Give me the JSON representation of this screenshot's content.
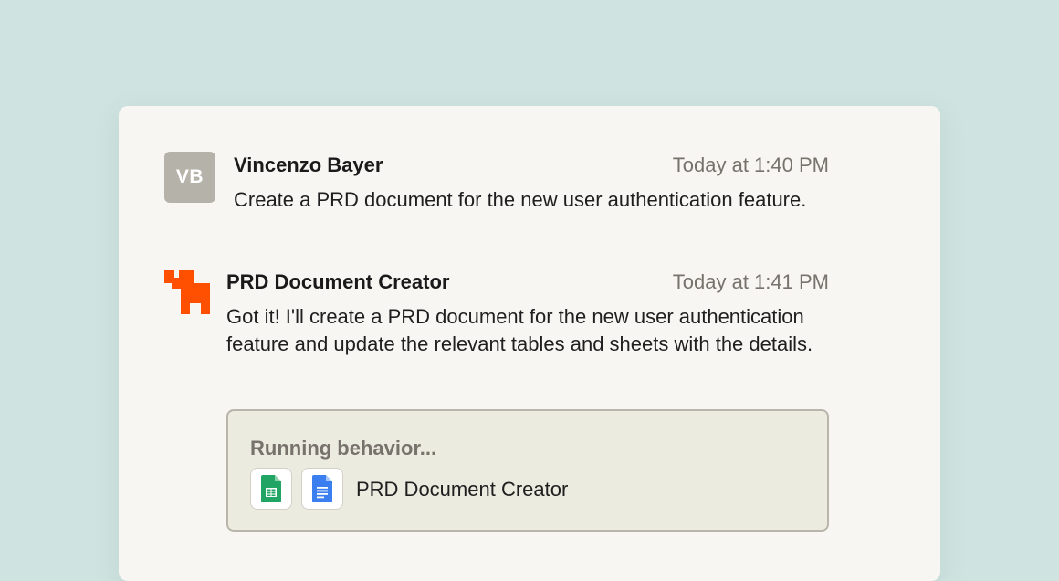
{
  "messages": [
    {
      "author": "Vincenzo Bayer",
      "avatar_initials": "VB",
      "timestamp": "Today at 1:40 PM",
      "text": "Create a PRD document for the new user authentication feature."
    },
    {
      "author": "PRD Document Creator",
      "avatar_icon": "zapier-logo-icon",
      "timestamp": "Today at 1:41 PM",
      "text": "Got it! I'll create a PRD document for the new user authentication feature and update the relevant tables and sheets with the details."
    }
  ],
  "run": {
    "status": "Running behavior...",
    "apps": [
      "google-sheets-icon",
      "google-docs-icon"
    ],
    "name": "PRD Document Creator"
  },
  "colors": {
    "page_background": "#cfe4e0",
    "panel_background": "#f7f6f2",
    "brand_orange": "#ff4f00",
    "sheets_green": "#21a464",
    "docs_blue": "#3a7ef0"
  }
}
